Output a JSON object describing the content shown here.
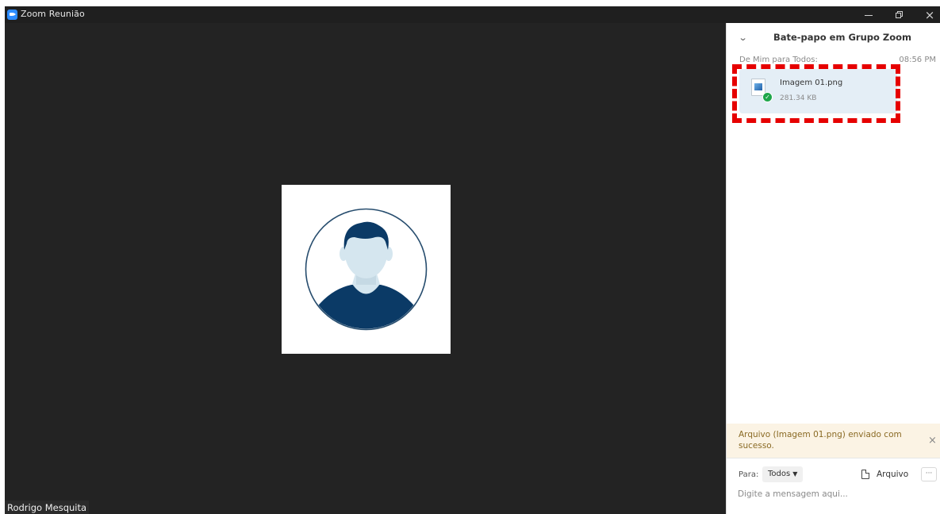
{
  "window": {
    "title": "Zoom Reunião",
    "app_icon": "zoom-icon",
    "controls": {
      "minimize": "minimize-icon",
      "restore": "restore-icon",
      "close": "×"
    }
  },
  "video": {
    "participant_name": "Rodrigo Mesquita",
    "avatar": "user-avatar-icon",
    "colors": {
      "background": "#232323",
      "avatar_dark": "#0b3a66",
      "avatar_face": "#d5e6ef"
    }
  },
  "chat": {
    "title": "Bate-papo em Grupo Zoom",
    "collapse_icon": "chevron-down-icon",
    "message": {
      "from_label": "De Mim para Todos:",
      "time": "08:56 PM",
      "file": {
        "name": "Imagem 01.png",
        "size": "281.34 KB",
        "icon": "image-file-icon",
        "status_icon": "check-circle-icon"
      }
    },
    "notice": {
      "text": "Arquivo (Imagem 01.png) enviado com sucesso.",
      "close_label": "×"
    },
    "compose": {
      "to_label": "Para:",
      "recipient": "Todos",
      "file_button": "Arquivo",
      "more_label": "···",
      "placeholder": "Digite a mensagem aqui..."
    }
  },
  "colors": {
    "accent": "#2d8cff",
    "success": "#1fa64a",
    "highlight": "#e60000",
    "notice_bg": "#fbf3e4",
    "file_card_bg": "#e4eef6"
  }
}
